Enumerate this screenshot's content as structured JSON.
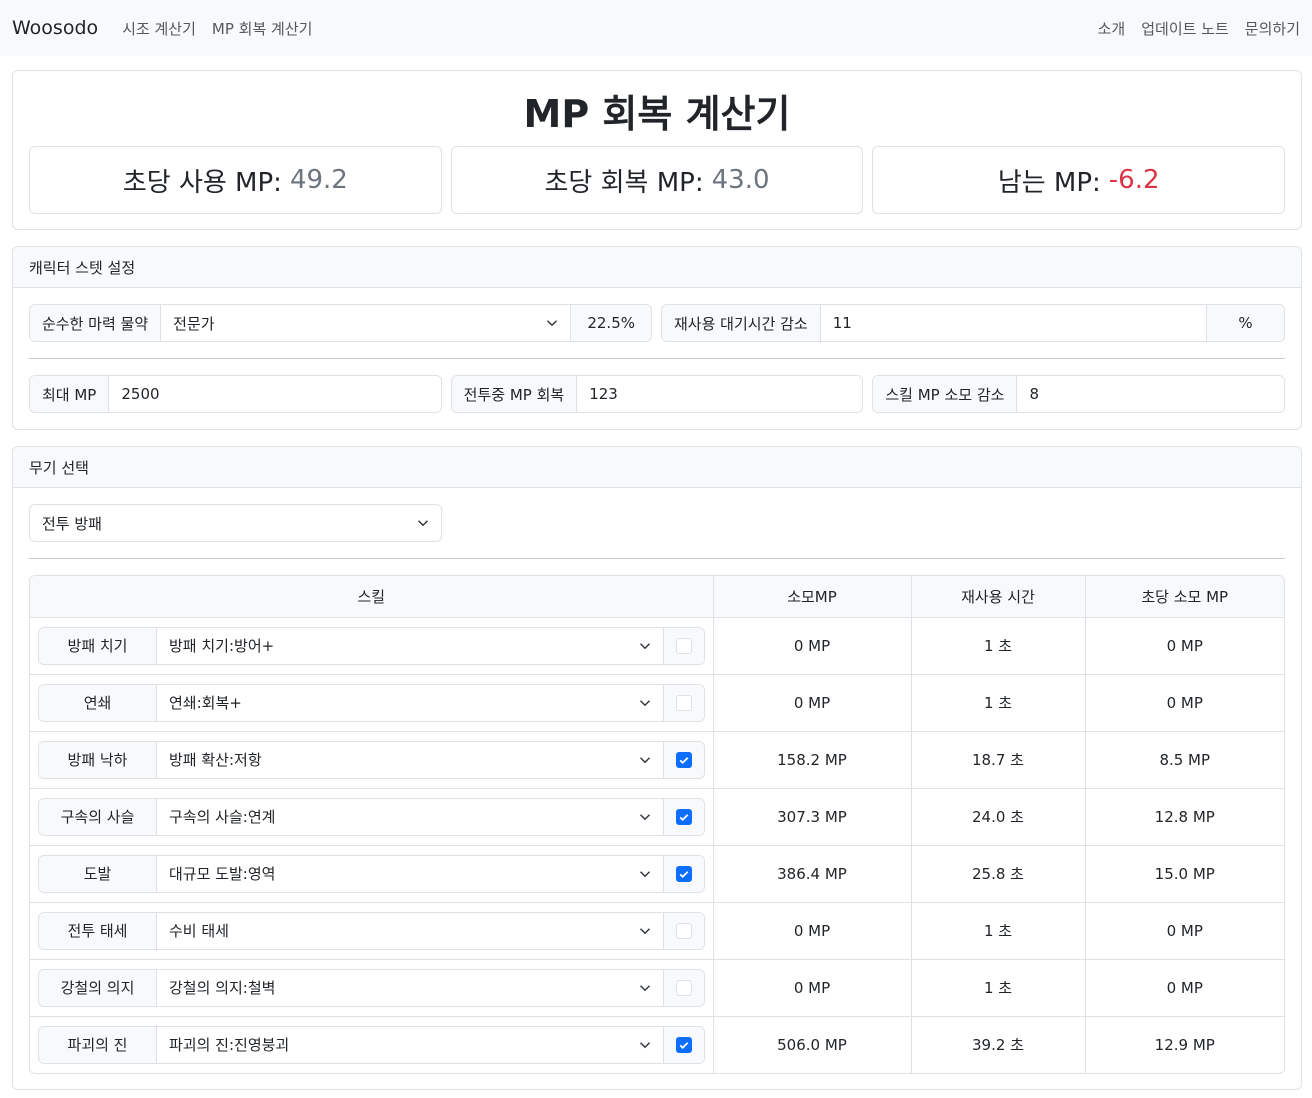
{
  "nav": {
    "brand": "Woosodo",
    "left_links": [
      "시조 계산기",
      "MP 회복 계산기"
    ],
    "right_links": [
      "소개",
      "업데이트 노트",
      "문의하기"
    ]
  },
  "summary": {
    "title": "MP 회복 계산기",
    "use_label": "초당 사용 MP:",
    "use_value": "49.2",
    "regen_label": "초당 회복 MP:",
    "regen_value": "43.0",
    "remain_label": "남는 MP:",
    "remain_value": "-6.2",
    "negative_color": "#dc3545"
  },
  "stats": {
    "header": "캐릭터 스텟 설정",
    "potion_label": "순수한 마력 물약",
    "potion_select": "전문가",
    "potion_percent": "22.5%",
    "cdr_label": "재사용 대기시간 감소",
    "cdr_value": "11",
    "cdr_unit": "%",
    "maxmp_label": "최대 MP",
    "maxmp_value": "2500",
    "combat_regen_label": "전투중 MP 회복",
    "combat_regen_value": "123",
    "skill_cost_label": "스킬 MP 소모 감소",
    "skill_cost_value": "8"
  },
  "weapon": {
    "header": "무기 선택",
    "selected": "전투 방패",
    "columns": [
      "스킬",
      "소모MP",
      "재사용 시간",
      "초당 소모 MP"
    ],
    "rows": [
      {
        "name": "방패 치기",
        "option": "방패 치기:방어+",
        "checked": false,
        "mp": "0 MP",
        "cd": "1 초",
        "mps": "0 MP"
      },
      {
        "name": "연쇄",
        "option": "연쇄:회복+",
        "checked": false,
        "mp": "0 MP",
        "cd": "1 초",
        "mps": "0 MP"
      },
      {
        "name": "방패 낙하",
        "option": "방패 확산:저항",
        "checked": true,
        "mp": "158.2 MP",
        "cd": "18.7 초",
        "mps": "8.5 MP"
      },
      {
        "name": "구속의 사슬",
        "option": "구속의 사슬:연계",
        "checked": true,
        "mp": "307.3 MP",
        "cd": "24.0 초",
        "mps": "12.8 MP"
      },
      {
        "name": "도발",
        "option": "대규모 도발:영역",
        "checked": true,
        "mp": "386.4 MP",
        "cd": "25.8 초",
        "mps": "15.0 MP"
      },
      {
        "name": "전투 태세",
        "option": "수비 태세",
        "checked": false,
        "mp": "0 MP",
        "cd": "1 초",
        "mps": "0 MP"
      },
      {
        "name": "강철의 의지",
        "option": "강철의 의지:철벽",
        "checked": false,
        "mp": "0 MP",
        "cd": "1 초",
        "mps": "0 MP"
      },
      {
        "name": "파괴의 진",
        "option": "파괴의 진:진영붕괴",
        "checked": true,
        "mp": "506.0 MP",
        "cd": "39.2 초",
        "mps": "12.9 MP"
      }
    ]
  },
  "colors": {
    "accent": "#0d6efd"
  }
}
